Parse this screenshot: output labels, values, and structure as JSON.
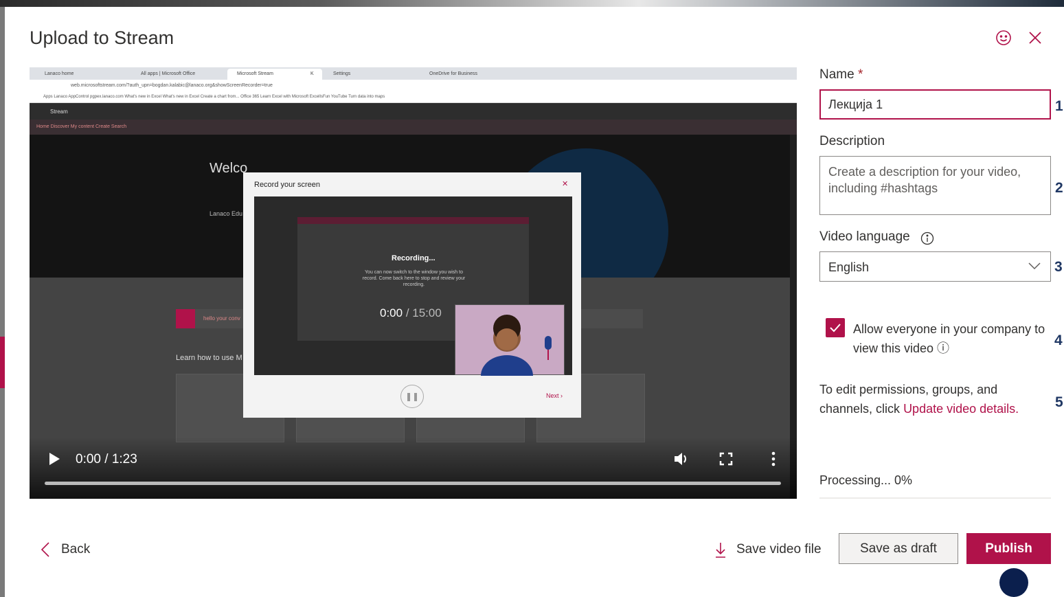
{
  "dialog": {
    "title": "Upload to Stream"
  },
  "video": {
    "browser_tabs": [
      "Lanaco home",
      "All apps | Microsoft Office",
      "Microsoft Stream",
      "K",
      "Settings",
      "OneDrive for Business"
    ],
    "address": "web.microsoftstream.com/?auth_upn=bogdan.kalabic@lanaco.org&showScreenRecorder=true",
    "bookmarks": "Apps   Lanaco AppControl   pgpex.lanaco.com   What's new in Excel   What's new in Excel   Create a chart from...   Office 365 Learn   Excel with Microsoft   ExcelIsFun YouTube   Turn data into maps",
    "stream_brand": "Stream",
    "stream_nav": "Home   Discover   My content   Create   Search",
    "hero_welcome": "Welco",
    "hero_edu": "Lanaco Edu",
    "learn_text": "Learn how to use M",
    "profile_hint": "hello your conv",
    "record_popup": {
      "title": "Record your screen",
      "recording": "Recording...",
      "description": "You can now switch to the window you wish to record. Come back here to stop and review your recording.",
      "timer_current": "0:00",
      "timer_total": " / 15:00",
      "next": "Next"
    },
    "time_display": "0:00 / 1:23",
    "progress_fraction": 0
  },
  "form": {
    "name_label": "Name",
    "required_mark": "*",
    "name_value": "Лекција 1",
    "description_label": "Description",
    "description_placeholder": "Create a description for your video, including #hashtags",
    "language_label": "Video language",
    "language_value": "English",
    "allow_checked": true,
    "allow_label": "Allow everyone in your company to view this video ⓘ",
    "permissions_text": "To edit permissions, groups, and channels, click ",
    "permissions_link": "Update video details.",
    "processing": "Processing... 0%"
  },
  "annotations": [
    "1",
    "2",
    "3",
    "4",
    "5"
  ],
  "footer": {
    "back": "Back",
    "save_file": "Save video file",
    "save_draft": "Save as draft",
    "publish": "Publish"
  },
  "colors": {
    "accent": "#b0124a",
    "annotation": "#203864",
    "cursor": "#0b1f4d"
  }
}
